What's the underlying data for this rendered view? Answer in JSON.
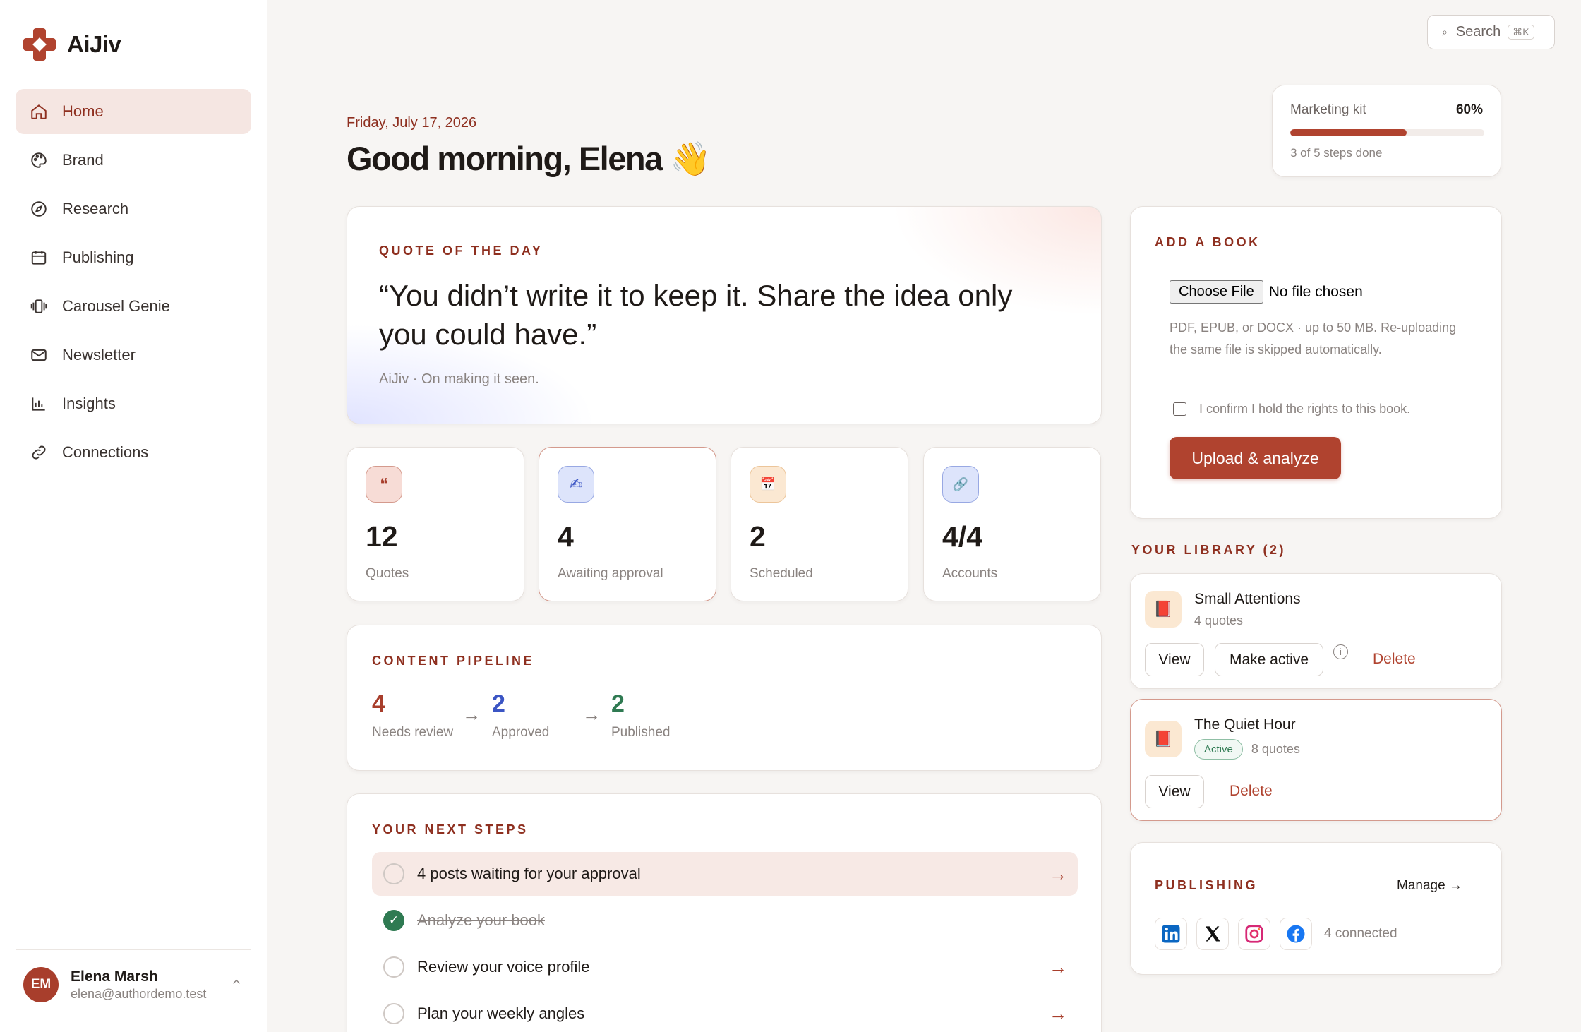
{
  "app": {
    "name": "AiJiv",
    "brand_color": "#b0432f"
  },
  "sidebar": {
    "items": [
      {
        "label": "Home",
        "icon": "home-icon",
        "active": true
      },
      {
        "label": "Brand",
        "icon": "palette-icon",
        "active": false
      },
      {
        "label": "Research",
        "icon": "compass-icon",
        "active": false
      },
      {
        "label": "Publishing",
        "icon": "calendar-icon",
        "active": false
      },
      {
        "label": "Carousel Genie",
        "icon": "carousel-icon",
        "active": false
      },
      {
        "label": "Newsletter",
        "icon": "mail-icon",
        "active": false
      },
      {
        "label": "Insights",
        "icon": "bar-chart-icon",
        "active": false
      },
      {
        "label": "Connections",
        "icon": "link-icon",
        "active": false
      }
    ],
    "user": {
      "initials": "EM",
      "name": "Elena Marsh",
      "email": "elena@authordemo.test"
    }
  },
  "search": {
    "label": "Search",
    "shortcut": "⌘K"
  },
  "header": {
    "date": "Friday, July 17, 2026",
    "greeting": "Good morning, Elena 👋"
  },
  "marketing_kit": {
    "title": "Marketing kit",
    "percent_label": "60%",
    "progress": 0.6,
    "steps": "3 of 5 steps done"
  },
  "quote": {
    "eyebrow": "QUOTE OF THE DAY",
    "text": "“You didn’t write it to keep it. Share the idea only you could have.”",
    "attribution": "AiJiv · On making it seen."
  },
  "stats": [
    {
      "value": "12",
      "label": "Quotes",
      "icon": "quote-icon",
      "glyph": "❝"
    },
    {
      "value": "4",
      "label": "Awaiting approval",
      "icon": "pen-icon",
      "glyph": "✍"
    },
    {
      "value": "2",
      "label": "Scheduled",
      "icon": "calendar-icon",
      "glyph": "📅"
    },
    {
      "value": "4/4",
      "label": "Accounts",
      "icon": "link-icon",
      "glyph": "🔗"
    }
  ],
  "pipeline": {
    "eyebrow": "CONTENT PIPELINE",
    "steps": [
      {
        "value": "4",
        "label": "Needs review",
        "color": "#a83e2c"
      },
      {
        "value": "2",
        "label": "Approved",
        "color": "#3b55c4"
      },
      {
        "value": "2",
        "label": "Published",
        "color": "#2f7a52"
      }
    ],
    "arrow": "→"
  },
  "next_steps": {
    "eyebrow": "YOUR NEXT STEPS",
    "items": [
      {
        "text": "4 posts waiting for your approval",
        "done": false,
        "arrow": "→"
      },
      {
        "text": "Analyze your book",
        "done": true,
        "arrow": ""
      },
      {
        "text": "Review your voice profile",
        "done": false,
        "arrow": "→"
      },
      {
        "text": "Plan your weekly angles",
        "done": false,
        "arrow": "→"
      }
    ]
  },
  "add_book": {
    "eyebrow": "ADD A BOOK",
    "file_button": "Choose File",
    "file_status": "No file chosen",
    "help": "PDF, EPUB, or DOCX · up to 50 MB. Re-uploading the same file is skipped automatically.",
    "confirm": "I confirm I hold the rights to this book.",
    "upload": "Upload & analyze"
  },
  "library": {
    "title": "YOUR LIBRARY (2)",
    "books": [
      {
        "title": "Small Attentions",
        "meta": "4 quotes",
        "active": false,
        "badge": "",
        "view": "View",
        "make_active": "Make active",
        "delete": "Delete",
        "info": "i"
      },
      {
        "title": "The Quiet Hour",
        "meta": "8 quotes",
        "active": true,
        "badge": "Active",
        "view": "View",
        "delete": "Delete"
      }
    ]
  },
  "publishing": {
    "eyebrow": "PUBLISHING",
    "manage": "Manage →",
    "networks": [
      "linkedin-icon",
      "x-icon",
      "instagram-icon",
      "facebook-icon"
    ],
    "connected": "4 connected"
  }
}
